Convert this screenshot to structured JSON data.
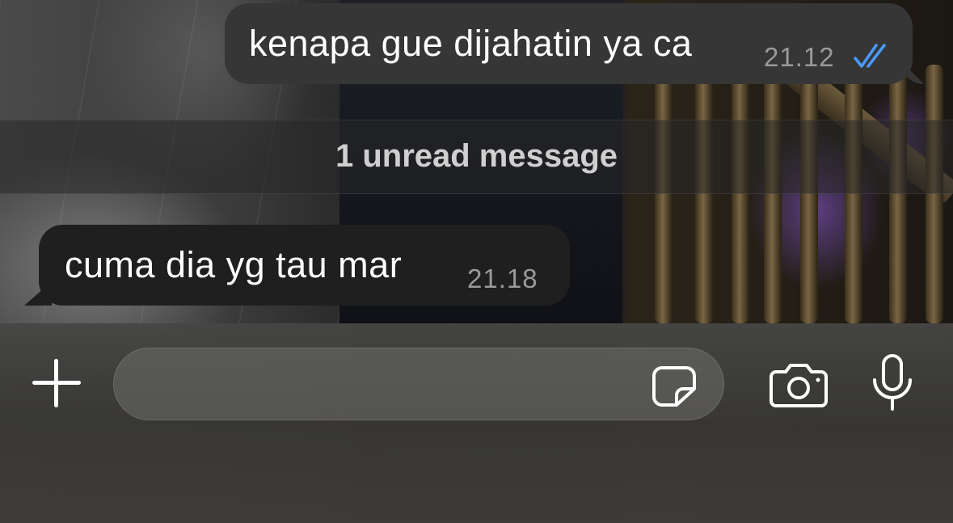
{
  "messages": [
    {
      "direction": "outgoing",
      "text": "kenapa gue dijahatin ya ca",
      "time": "21.12",
      "status_icon": "double-check-read-icon",
      "status_color": "#4a9bff"
    },
    {
      "direction": "incoming",
      "text": "cuma dia yg tau mar",
      "time": "21.18"
    }
  ],
  "unread_divider": {
    "label": "1 unread message"
  },
  "composer": {
    "attach_icon": "plus-icon",
    "input_value": "",
    "sticker_icon": "sticker-icon",
    "camera_icon": "camera-icon",
    "mic_icon": "microphone-icon"
  },
  "colors": {
    "outgoing_bubble": "#363636",
    "incoming_bubble": "#1f1f1f",
    "timestamp": "#9a9a9a",
    "read_ticks": "#4a9bff"
  }
}
